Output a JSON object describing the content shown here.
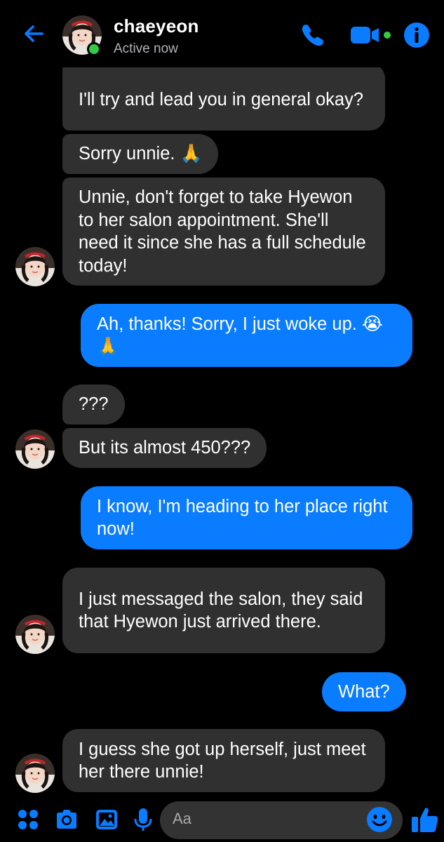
{
  "header": {
    "contact_name": "chaeyeon",
    "status": "Active now"
  },
  "messages": [
    {
      "side": "in",
      "text": "I'll try and lead you in general okay?"
    },
    {
      "side": "in",
      "text": "Sorry unnie. 🙏"
    },
    {
      "side": "in",
      "text": "Unnie, don't forget to take Hyewon to her salon appointment. She'll need it since she has a full schedule today!"
    },
    {
      "side": "out",
      "text": "Ah, thanks! Sorry, I just woke up. 😭🙏"
    },
    {
      "side": "in",
      "text": "???"
    },
    {
      "side": "in",
      "text": "But its almost 450???"
    },
    {
      "side": "out",
      "text": "I know, I'm heading to her place right now!"
    },
    {
      "side": "in",
      "text": "I just messaged the salon, they said that Hyewon just arrived there."
    },
    {
      "side": "out",
      "text": "What?"
    },
    {
      "side": "in",
      "text": "I guess she got up herself, just meet her there unnie!"
    }
  ],
  "composer": {
    "placeholder": "Aa"
  },
  "colors": {
    "accent": "#0a7cff",
    "incoming_bubble": "#303030",
    "active": "#31cc46"
  },
  "icons": [
    "back-arrow-icon",
    "phone-icon",
    "video-camera-icon",
    "info-icon",
    "apps-icon",
    "camera-icon",
    "gallery-icon",
    "microphone-icon",
    "emoji-icon",
    "thumbs-up-icon"
  ]
}
